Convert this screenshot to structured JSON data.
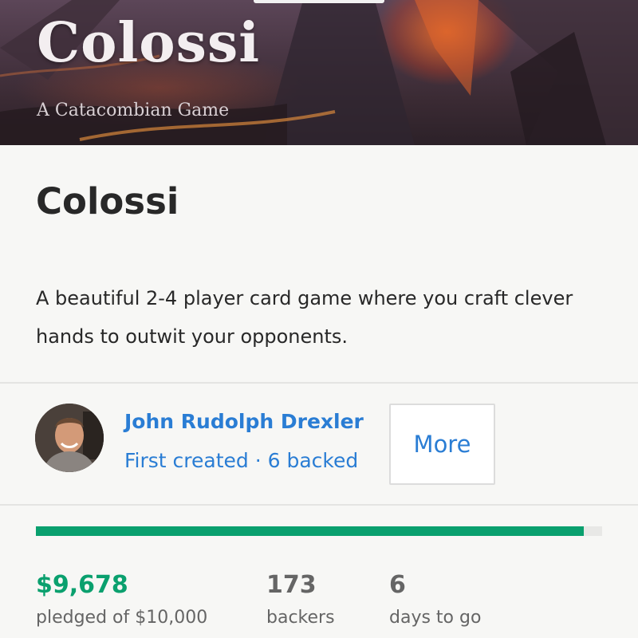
{
  "hero": {
    "title": "Colossi",
    "subtitle": "A Catacombian Game"
  },
  "project": {
    "title": "Colossi",
    "blurb": "A beautiful 2-4 player card game where you craft clever hands to outwit your opponents."
  },
  "creator": {
    "name": "John Rudolph Drexler",
    "meta": "First created · 6 backed",
    "more_label": "More"
  },
  "funding": {
    "progress_fraction": 0.968,
    "pledged_value": "$9,678",
    "pledged_label": "pledged of $10,000",
    "backers_value": "173",
    "backers_label": "backers",
    "days_value": "6",
    "days_label": "days to go"
  },
  "colors": {
    "accent_green": "#0aa06e",
    "link_blue": "#2a7dd4",
    "text_dark": "#282828"
  }
}
